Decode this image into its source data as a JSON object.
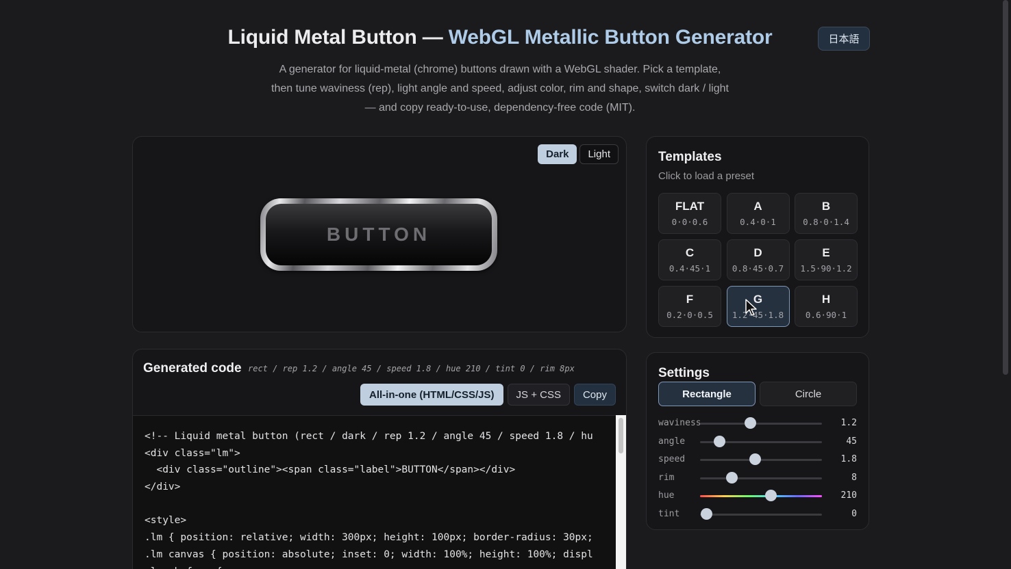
{
  "header": {
    "title_main": "Liquid Metal Button — ",
    "title_accent": "WebGL Metallic Button Generator",
    "lang_label": "日本語",
    "description": "A generator for liquid-metal (chrome) buttons drawn with a WebGL shader. Pick a template, then tune waviness (rep), light angle and speed, adjust color, rim and shape, switch dark / light — and copy ready-to-use, dependency-free code (MIT)."
  },
  "preview": {
    "theme_dark": "Dark",
    "theme_light": "Light",
    "button_label": "BUTTON"
  },
  "code": {
    "title": "Generated code",
    "meta": "rect / rep 1.2 / angle 45 / speed 1.8 / hue 210 / tint 0 / rim 8px",
    "tab_all": "All-in-one (HTML/CSS/JS)",
    "tab_split": "JS + CSS",
    "copy_label": "Copy",
    "lines": [
      "<!-- Liquid metal button (rect / dark / rep 1.2 / angle 45 / speed 1.8 / hu",
      "<div class=\"lm\">",
      "  <div class=\"outline\"><span class=\"label\">BUTTON</span></div>",
      "</div>",
      "",
      "<style>",
      ".lm { position: relative; width: 300px; height: 100px; border-radius: 30px;",
      ".lm canvas { position: absolute; inset: 0; width: 100%; height: 100%; displ",
      ".lm::before {"
    ]
  },
  "templates": {
    "title": "Templates",
    "subtitle": "Click to load a preset",
    "items": [
      {
        "name": "FLAT",
        "params": "0·0·0.6"
      },
      {
        "name": "A",
        "params": "0.4·0·1"
      },
      {
        "name": "B",
        "params": "0.8·0·1.4"
      },
      {
        "name": "C",
        "params": "0.4·45·1"
      },
      {
        "name": "D",
        "params": "0.8·45·0.7"
      },
      {
        "name": "E",
        "params": "1.5·90·1.2"
      },
      {
        "name": "F",
        "params": "0.2·0·0.5"
      },
      {
        "name": "G",
        "params": "1.2·45·1.8"
      },
      {
        "name": "H",
        "params": "0.6·90·1"
      }
    ]
  },
  "settings": {
    "title": "Settings",
    "shape_rect": "Rectangle",
    "shape_circle": "Circle",
    "sliders": [
      {
        "label": "waviness",
        "value": "1.2",
        "fraction": 0.41
      },
      {
        "label": "angle",
        "value": "45",
        "fraction": 0.16
      },
      {
        "label": "speed",
        "value": "1.8",
        "fraction": 0.45
      },
      {
        "label": "rim",
        "value": "8",
        "fraction": 0.26
      },
      {
        "label": "hue",
        "value": "210",
        "fraction": 0.58
      },
      {
        "label": "tint",
        "value": "0",
        "fraction": 0.05
      }
    ]
  }
}
